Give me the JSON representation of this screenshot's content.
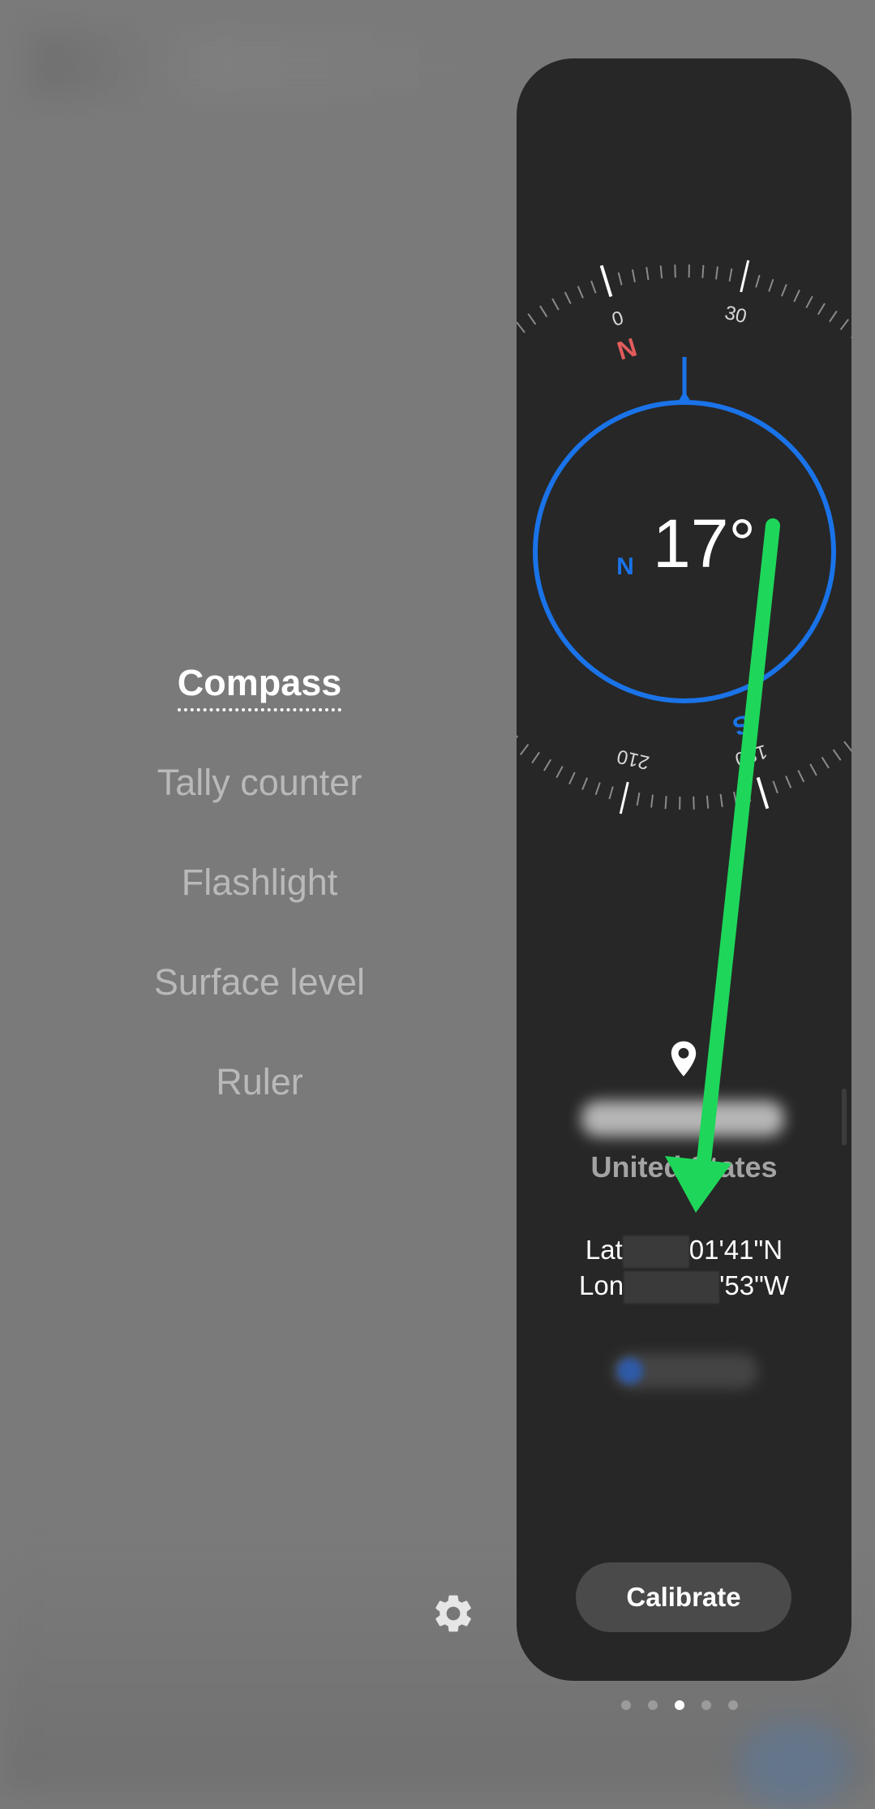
{
  "tools": {
    "items": [
      {
        "label": "Compass",
        "active": true
      },
      {
        "label": "Tally counter",
        "active": false
      },
      {
        "label": "Flashlight",
        "active": false
      },
      {
        "label": "Surface level",
        "active": false
      },
      {
        "label": "Ruler",
        "active": false
      }
    ]
  },
  "compass": {
    "heading": "17°",
    "inner_north_label": "N",
    "dial_north_label": "N",
    "dial_south_label": "S",
    "tick_labels": [
      "0",
      "30",
      "210",
      "180"
    ],
    "location": {
      "city": "",
      "country": "United States",
      "lat_prefix": "Lat",
      "lat_suffix": "01'41\"N",
      "lon_prefix": "Lon",
      "lon_suffix": "'53\"W"
    },
    "calibrate_label": "Calibrate"
  },
  "pagination": {
    "count": 5,
    "active_index": 2
  },
  "colors": {
    "accent_blue": "#1a73e8",
    "north_red": "#e25c5c",
    "card_bg": "#272727",
    "overlay_arrow_green": "#1ed75a"
  },
  "icons": {
    "settings": "gear-icon",
    "location": "location-pin-icon"
  }
}
